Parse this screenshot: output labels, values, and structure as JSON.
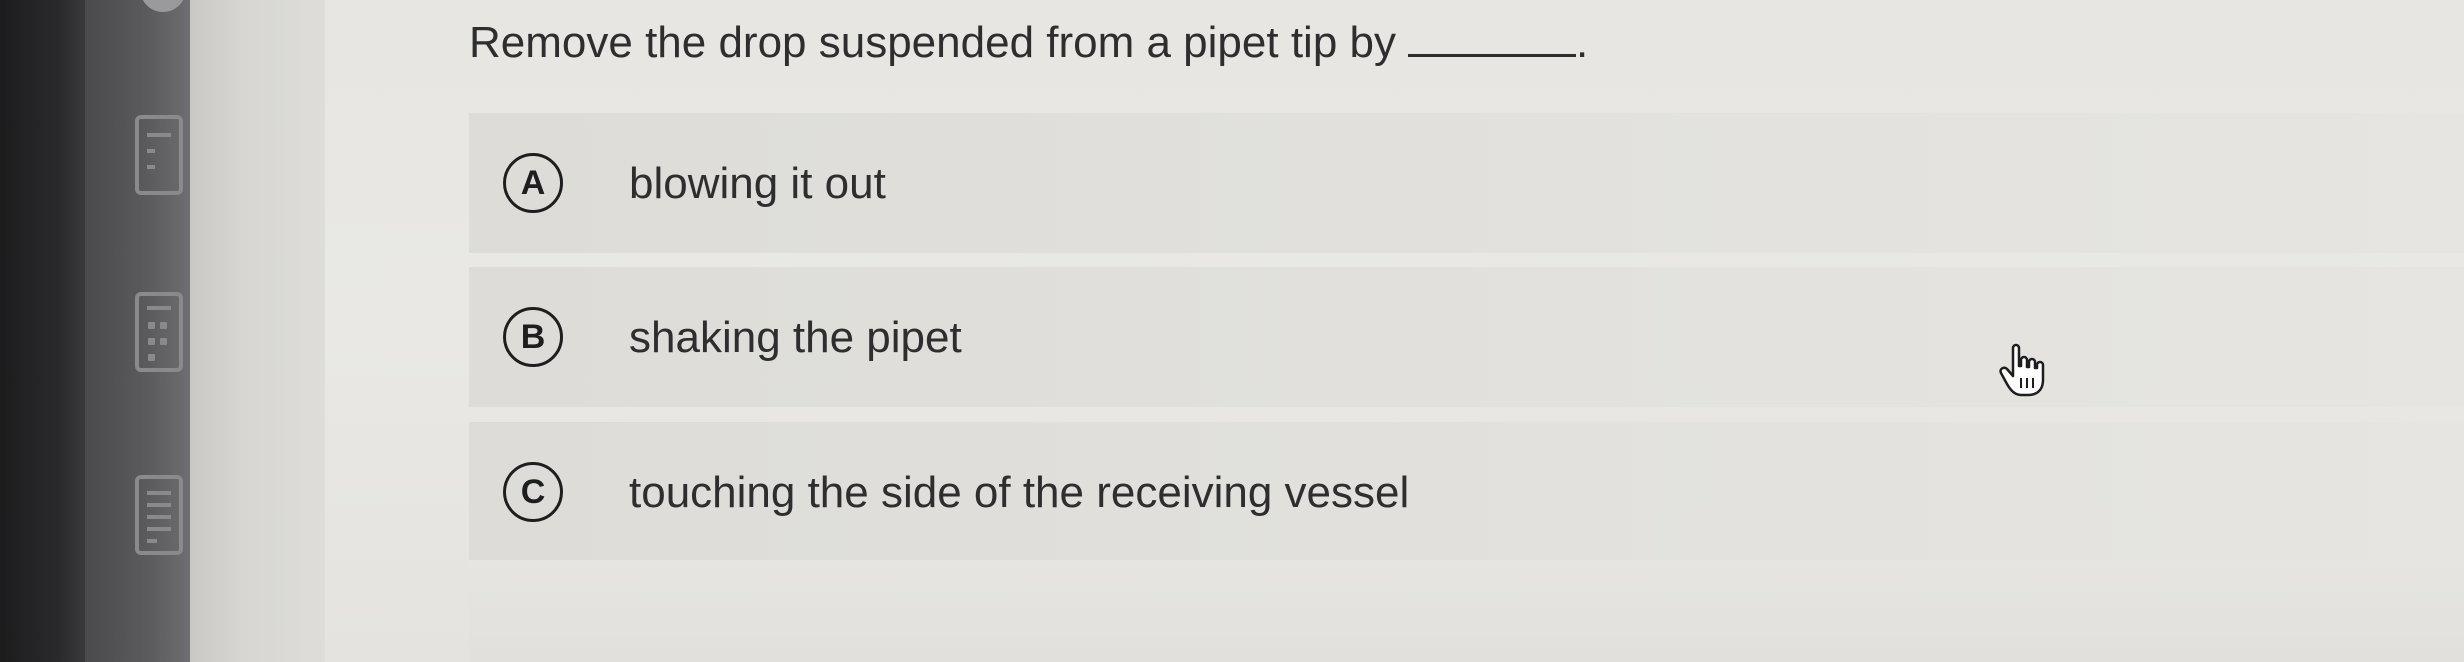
{
  "question": {
    "text": "Remove the drop suspended from a pipet tip by",
    "end_punct": "."
  },
  "options": [
    {
      "letter": "A",
      "text": "blowing it out"
    },
    {
      "letter": "B",
      "text": "shaking the pipet"
    },
    {
      "letter": "C",
      "text": "touching the side of the receiving vessel"
    }
  ],
  "icons": {
    "sidebar": [
      "calculator-icon",
      "grid-calendar-icon",
      "document-list-icon"
    ],
    "cursor": "hand-pointer-icon"
  },
  "colors": {
    "text": "#2e2e2f",
    "option_bg": "#e2e1dd",
    "bezel": "#1c1c1d"
  }
}
